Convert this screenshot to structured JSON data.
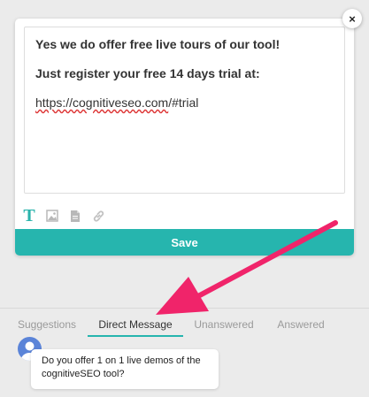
{
  "editor": {
    "line1": "Yes we do offer free live tours of our tool!",
    "line2": "Just register your free 14 days trial at:",
    "link_underlined": "https://cognitiveseo.com",
    "link_rest": "/#trial",
    "close_label": "×"
  },
  "toolbar": {
    "icons": [
      "text-format-icon",
      "image-icon",
      "document-icon",
      "link-icon"
    ],
    "text_glyph": "T"
  },
  "save_label": "Save",
  "tabs": [
    {
      "label": "Suggestions",
      "active": false
    },
    {
      "label": "Direct Message",
      "active": true
    },
    {
      "label": "Unanswered",
      "active": false
    },
    {
      "label": "Answered",
      "active": false
    }
  ],
  "message": {
    "text": "Do you offer 1 on 1 live demos of the cognitiveSEO tool?"
  },
  "colors": {
    "accent": "#26b5ae",
    "arrow": "#f0246a",
    "background": "#ebebeb",
    "avatar": "#5b84d8"
  }
}
